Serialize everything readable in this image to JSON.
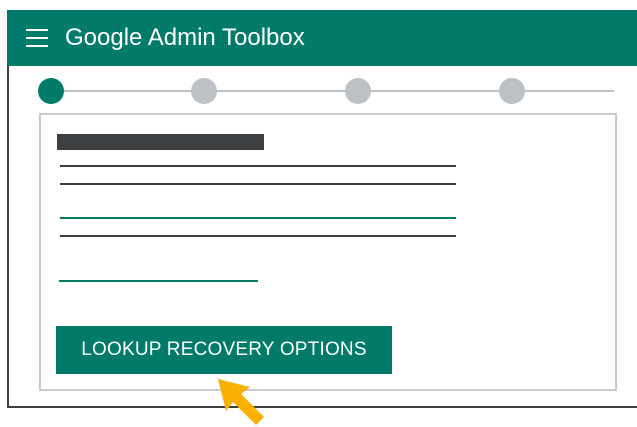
{
  "header": {
    "title": "Google Admin Toolbox",
    "menu_icon": "hamburger-menu-icon",
    "background_color": "#007b69"
  },
  "stepper": {
    "steps": [
      {
        "state": "active",
        "color": "#007b69"
      },
      {
        "state": "inactive",
        "color": "#bdc1c6"
      },
      {
        "state": "inactive",
        "color": "#bdc1c6"
      },
      {
        "state": "inactive",
        "color": "#bdc1c6"
      }
    ]
  },
  "form": {
    "lookup_button_label": "LOOKUP RECOVERY OPTIONS"
  },
  "pointer": {
    "icon": "cursor-arrow-icon",
    "color": "#f9b000"
  }
}
